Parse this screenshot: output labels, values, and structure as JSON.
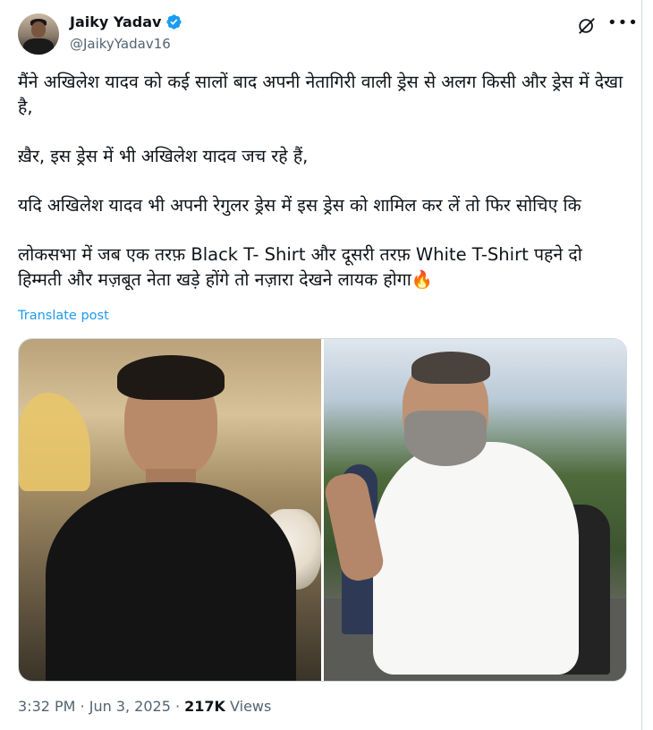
{
  "author": {
    "name": "Jaiky Yadav",
    "handle": "@JaikyYadav16",
    "verified_color": "#1d9bf0"
  },
  "post": {
    "paragraphs": [
      "मैंने अखिलेश यादव को कई सालों बाद अपनी नेतागिरी वाली ड्रेस से अलग किसी और ड्रेस में देखा है,",
      "ख़ैर, इस ड्रेस में भी अखिलेश यादव जच रहे हैं,",
      "यदि अखिलेश यादव भी अपनी रेगुलर ड्रेस में इस ड्रेस को शामिल कर लें तो फिर सोचिए कि",
      "लोकसभा में जब एक तरफ़ Black T- Shirt और दूसरी तरफ़ White T-Shirt पहने दो हिम्मती और मज़बूत नेता खड़े होंगे तो नज़ारा देखने लायक होगा🔥"
    ],
    "translate_label": "Translate post"
  },
  "meta": {
    "time": "3:32 PM",
    "separator": " · ",
    "date": "Jun 3, 2025",
    "views_count": "217K",
    "views_label": " Views"
  },
  "icons": {
    "verified": "verified-badge-icon",
    "grok": "grok-icon",
    "more": "more-options-icon"
  }
}
